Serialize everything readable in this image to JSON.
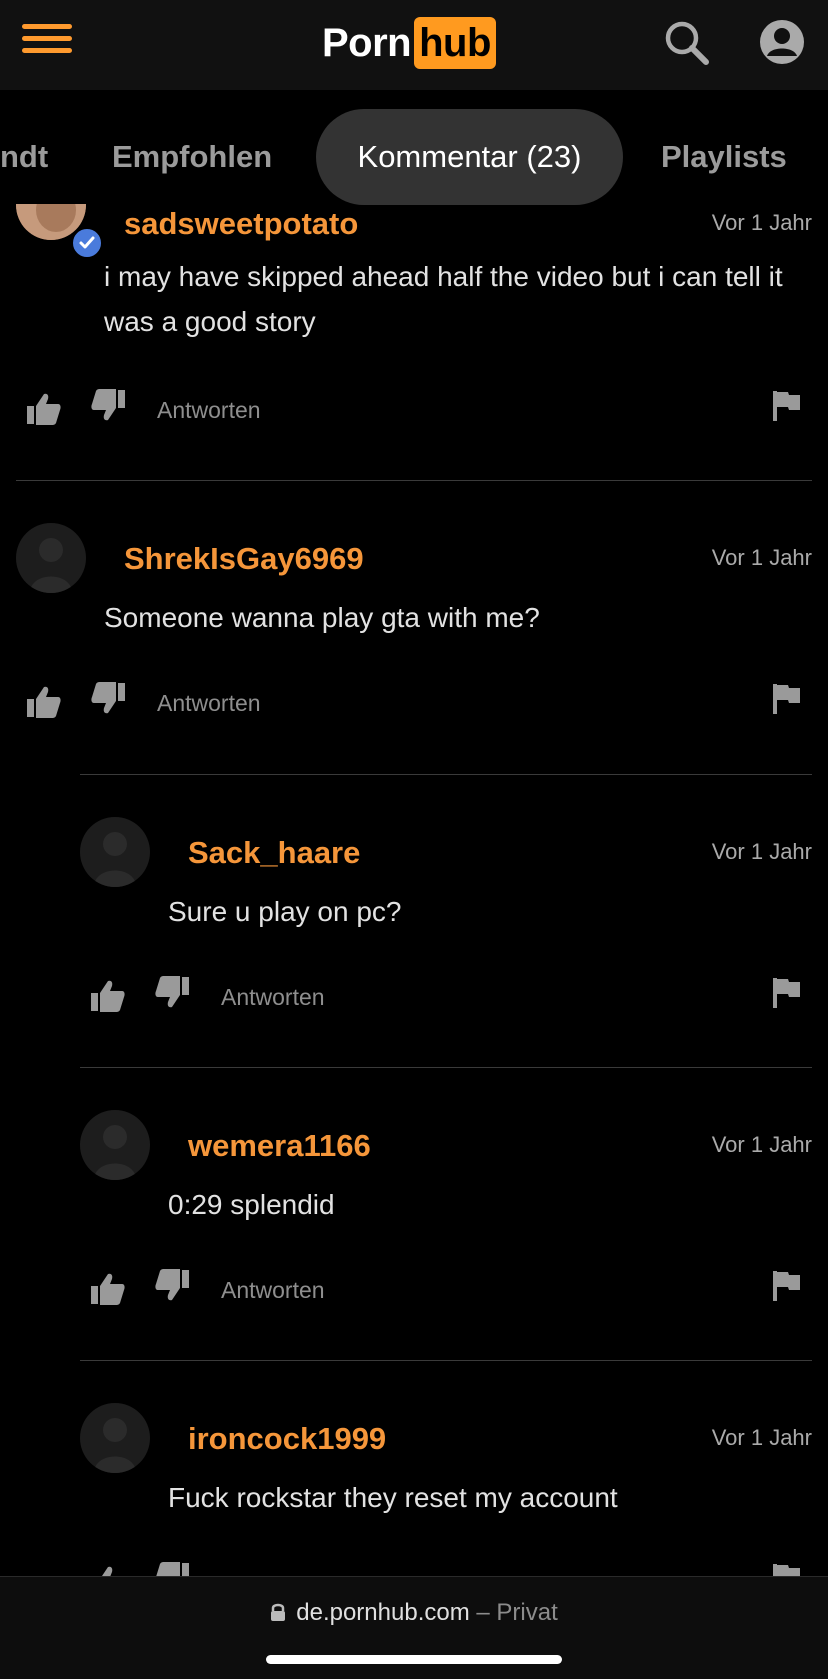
{
  "header": {
    "logo_left": "Porn",
    "logo_right": "hub",
    "menu_icon": "hamburger-menu-icon",
    "search_icon": "search-icon",
    "account_icon": "account-icon",
    "accent": "#ff9a1f"
  },
  "tabs": [
    {
      "label": "ndt"
    },
    {
      "label": "Empfohlen"
    },
    {
      "label": "Kommentar (23)",
      "active": true
    },
    {
      "label": "Playlists"
    }
  ],
  "comments": [
    {
      "username": "sadsweetpotato",
      "time": "Vor 1 Jahr",
      "text": "i may have skipped ahead half the video but i can tell it was a good story",
      "reply_label": "Antworten",
      "verified": true
    },
    {
      "username": "ShrekIsGay6969",
      "time": "Vor 1 Jahr",
      "text": "Someone wanna play gta with me?",
      "reply_label": "Antworten"
    },
    {
      "username": "Sack_haare",
      "time": "Vor 1 Jahr",
      "text": "Sure u play on pc?",
      "reply_label": "Antworten"
    },
    {
      "username": "wemera1166",
      "time": "Vor 1 Jahr",
      "text": "0:29 splendid",
      "reply_label": "Antworten"
    },
    {
      "username": "ironcock1999",
      "time": "Vor 1 Jahr",
      "text": "Fuck rockstar they reset my account",
      "reply_label": "Antworten"
    }
  ],
  "urlbar": {
    "domain": "de.pornhub.com",
    "mode": "– Privat"
  }
}
